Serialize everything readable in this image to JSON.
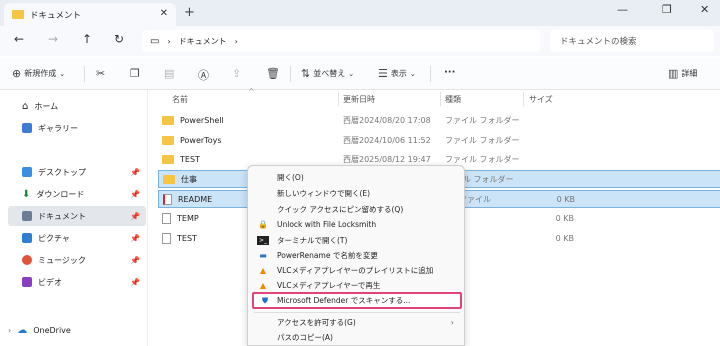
{
  "window": {
    "tab_title": "ドキュメント",
    "new_tab": "+",
    "close_tab": "✕"
  },
  "address": {
    "breadcrumb": "ドキュメント",
    "search_placeholder": "ドキュメントの検索"
  },
  "toolbar": {
    "new_label": "新規作成",
    "sort_label": "並べ替え",
    "view_label": "表示",
    "more_label": "···",
    "details_label": "詳細"
  },
  "sidebar": {
    "items": [
      {
        "label": "ホーム"
      },
      {
        "label": "ギャラリー"
      },
      {
        "label": "デスクトップ"
      },
      {
        "label": "ダウンロード"
      },
      {
        "label": "ドキュメント"
      },
      {
        "label": "ピクチャ"
      },
      {
        "label": "ミュージック"
      },
      {
        "label": "ビデオ"
      },
      {
        "label": "OneDrive"
      }
    ]
  },
  "list": {
    "columns": [
      "名前",
      "更新日時",
      "種類",
      "サイズ"
    ],
    "rows": [
      {
        "name": "PowerShell",
        "date": "西暦2024/08/20 17:08",
        "type": "ファイル フォルダー",
        "size": ""
      },
      {
        "name": "PowerToys",
        "date": "西暦2024/10/06 11:52",
        "type": "ファイル フォルダー",
        "size": ""
      },
      {
        "name": "TEST",
        "date": "西暦2025/08/12 19:47",
        "type": "ファイル フォルダー",
        "size": ""
      },
      {
        "name": "仕事",
        "date": "",
        "type": "ル フォルダー",
        "size": ""
      },
      {
        "name": "README",
        "date": "",
        "type": "ファイル",
        "size": "0 KB"
      },
      {
        "name": "TEMP",
        "date": "",
        "type": "",
        "size": "0 KB"
      },
      {
        "name": "TEST",
        "date": "",
        "type": "",
        "size": "0 KB"
      }
    ]
  },
  "context_menu": {
    "items": [
      {
        "label": "開く(O)"
      },
      {
        "label": "新しいウィンドウで開く(E)"
      },
      {
        "label": "クイック アクセスにピン留めする(Q)"
      },
      {
        "label": "Unlock with File Locksmith"
      },
      {
        "label": "ターミナルで開く(T)"
      },
      {
        "label": "PowerRename で名前を変更"
      },
      {
        "label": "VLCメディアプレイヤーのプレイリストに追加"
      },
      {
        "label": "VLCメディアプレイヤーで再生"
      },
      {
        "label": "Microsoft Defender でスキャンする..."
      },
      {
        "label": "アクセスを許可する(G)"
      },
      {
        "label": "パスのコピー(A)"
      }
    ]
  },
  "colors": {
    "highlight_border": "#e0447a",
    "selection": "#cce4f7"
  }
}
